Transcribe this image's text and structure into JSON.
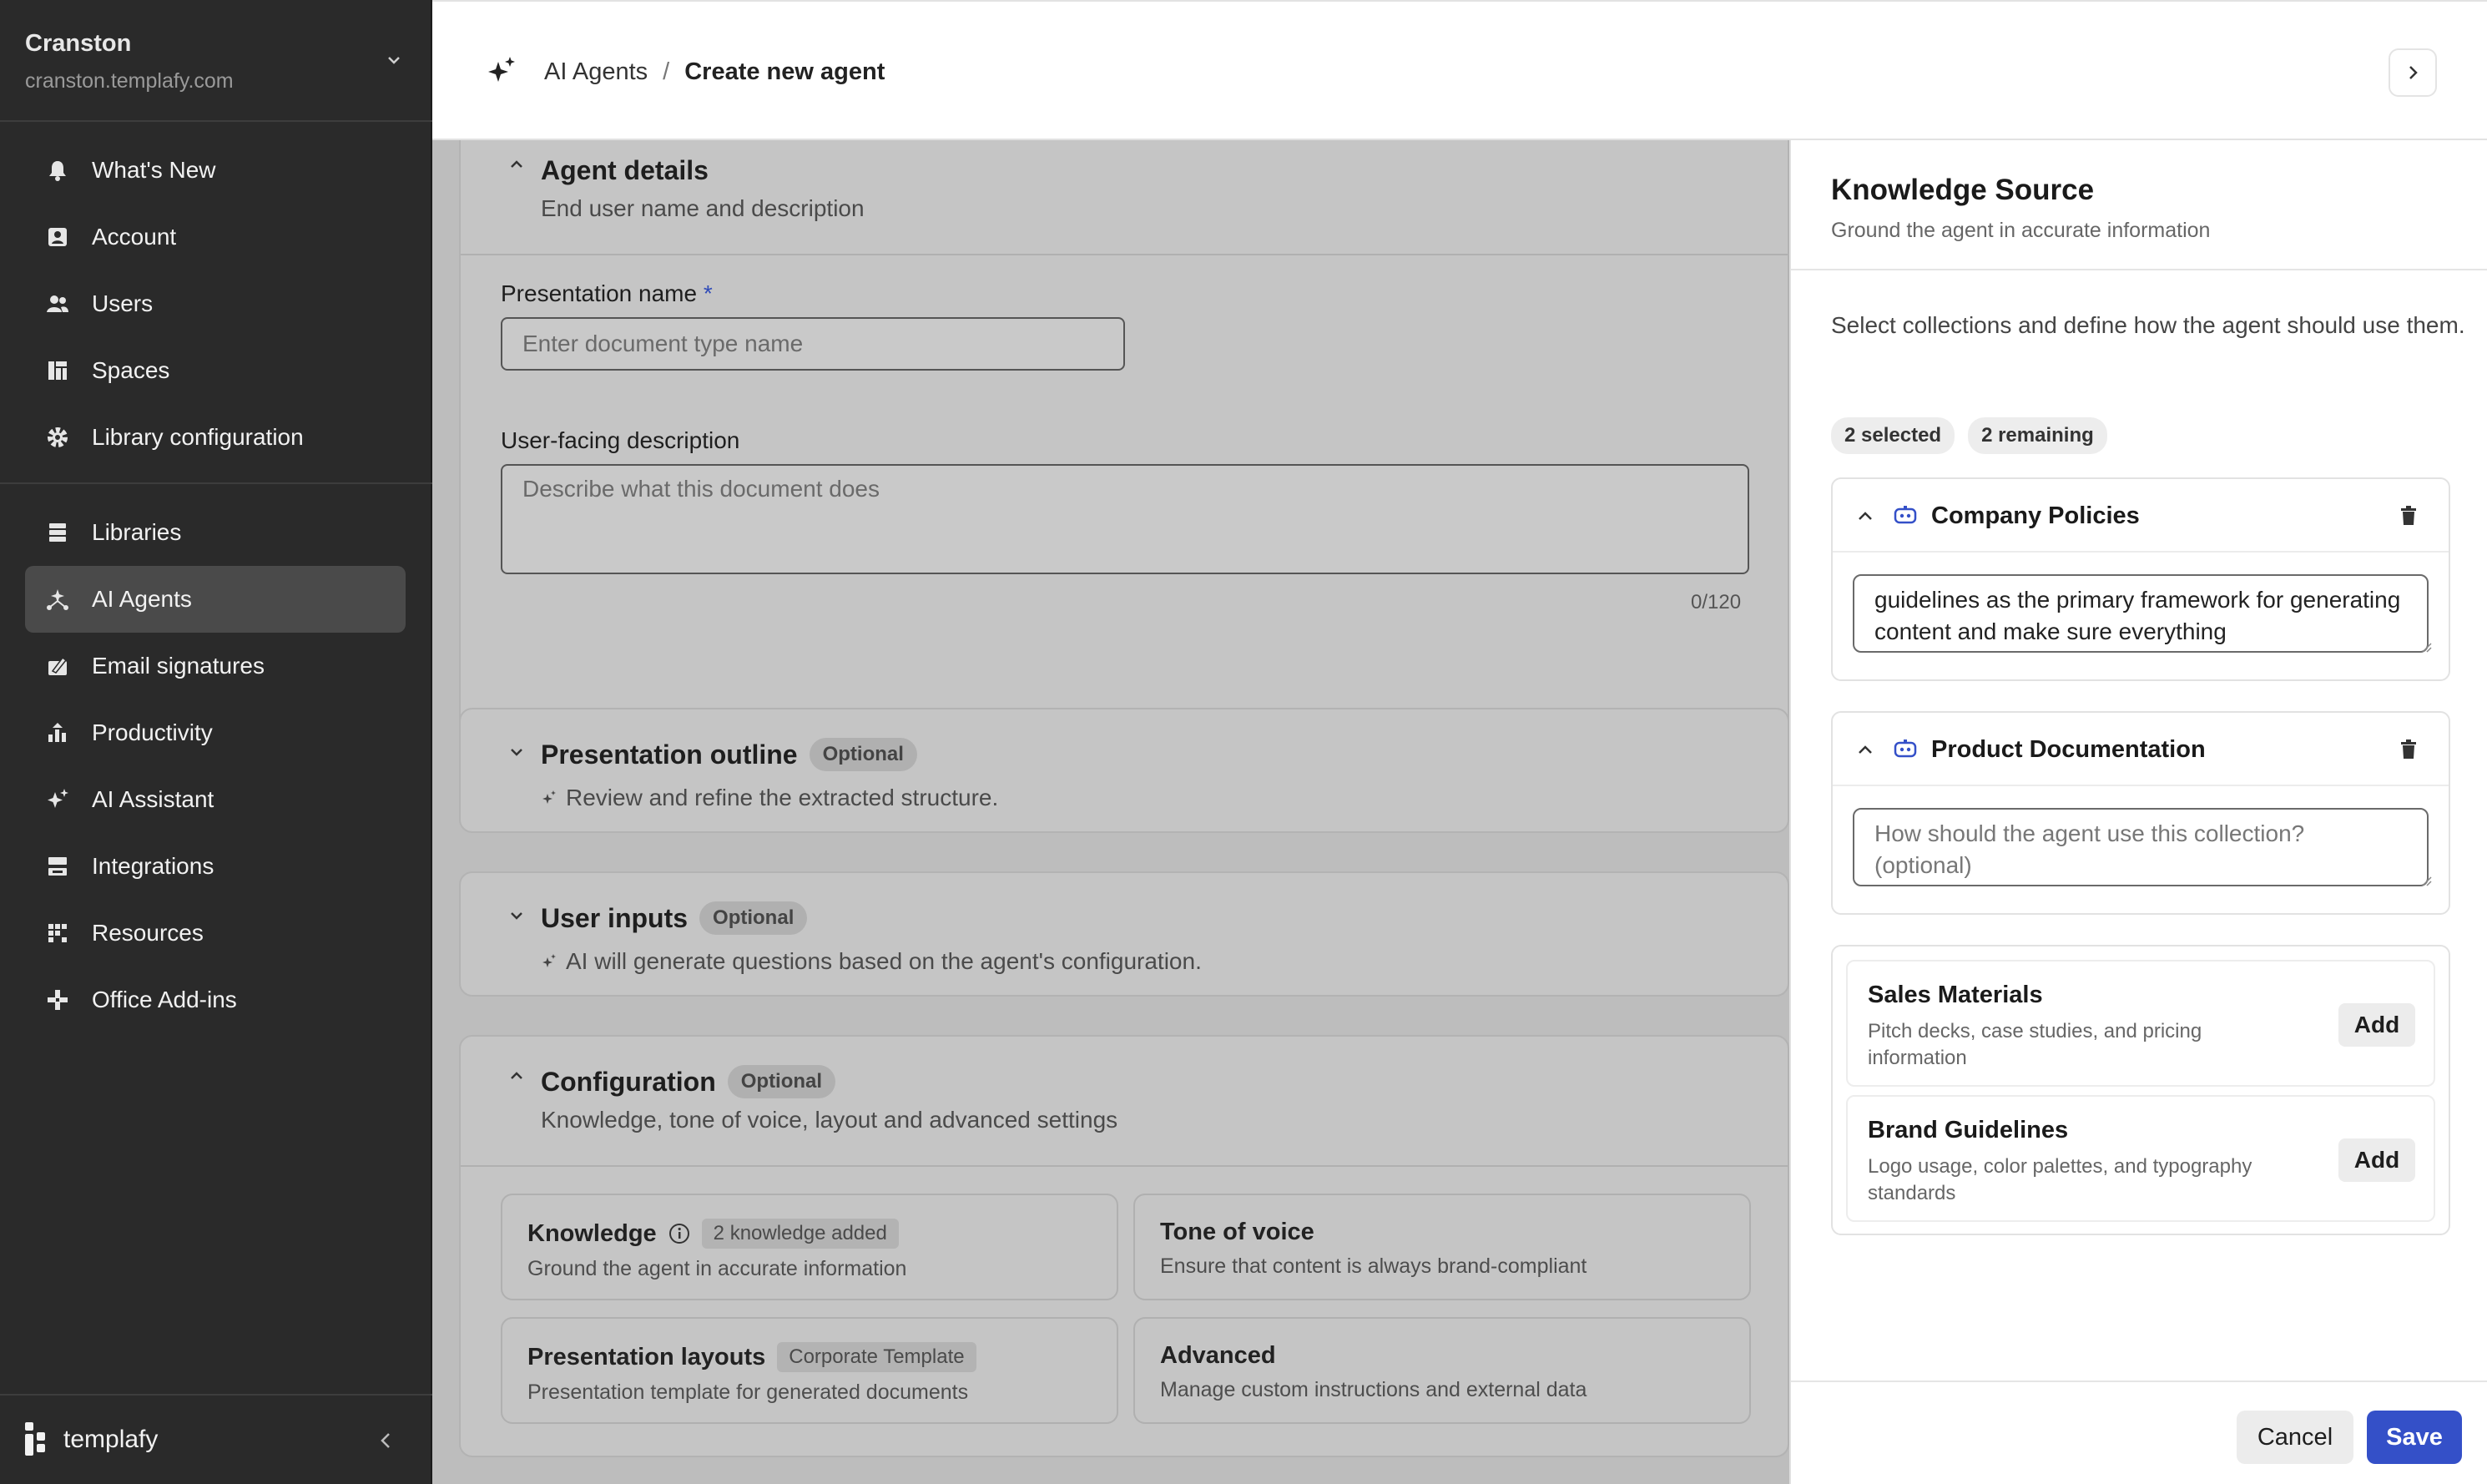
{
  "org": {
    "name": "Cranston",
    "domain": "cranston.templafy.com"
  },
  "nav_group1": [
    {
      "label": "What's New",
      "icon": "bell-icon"
    },
    {
      "label": "Account",
      "icon": "account-icon"
    },
    {
      "label": "Users",
      "icon": "users-icon"
    },
    {
      "label": "Spaces",
      "icon": "spaces-icon"
    },
    {
      "label": "Library configuration",
      "icon": "gear-icon"
    }
  ],
  "nav_group2": [
    {
      "label": "Libraries",
      "icon": "libraries-icon"
    },
    {
      "label": "AI Agents",
      "icon": "ai-agents-icon",
      "active": true
    },
    {
      "label": "Email signatures",
      "icon": "signature-icon"
    },
    {
      "label": "Productivity",
      "icon": "productivity-icon"
    },
    {
      "label": "AI Assistant",
      "icon": "sparkle-icon"
    },
    {
      "label": "Integrations",
      "icon": "integrations-icon"
    },
    {
      "label": "Resources",
      "icon": "resources-icon"
    },
    {
      "label": "Office Add-ins",
      "icon": "addins-icon"
    }
  ],
  "brand": "templafy",
  "breadcrumb": {
    "parent": "AI Agents",
    "separator": "/",
    "current": "Create new agent"
  },
  "agent_details": {
    "title": "Agent details",
    "subtitle": "End user name and description",
    "name_label": "Presentation name",
    "required_mark": "*",
    "name_placeholder": "Enter document type name",
    "desc_label": "User-facing description",
    "desc_placeholder": "Describe what this document does",
    "counter": "0/120"
  },
  "outline": {
    "title": "Presentation outline",
    "badge": "Optional",
    "subtitle": "Review and refine the extracted structure."
  },
  "user_inputs": {
    "title": "User inputs",
    "badge": "Optional",
    "subtitle": "AI will generate questions based on the agent's configuration."
  },
  "configuration": {
    "title": "Configuration",
    "badge": "Optional",
    "subtitle": "Knowledge, tone of voice, layout and advanced settings",
    "knowledge": {
      "title": "Knowledge",
      "tag": "2 knowledge added",
      "desc": "Ground the agent in accurate information"
    },
    "tone": {
      "title": "Tone of voice",
      "desc": "Ensure that content is always brand-compliant"
    },
    "layouts": {
      "title": "Presentation layouts",
      "tag": "Corporate Template",
      "desc": "Presentation template for generated documents"
    },
    "advanced": {
      "title": "Advanced",
      "desc": "Manage custom instructions and external data"
    }
  },
  "panel": {
    "title": "Knowledge Source",
    "subtitle": "Ground the agent in accurate information",
    "intro": "Select collections and define how the agent should use them.",
    "selected_chip": "2 selected",
    "remaining_chip": "2 remaining",
    "collections": [
      {
        "name": "Company Policies",
        "text": "guidelines as the primary framework for generating content and make sure everything"
      },
      {
        "name": "Product Documentation",
        "placeholder": "How should the agent use this collection? (optional)"
      }
    ],
    "available": [
      {
        "name": "Sales Materials",
        "desc": "Pitch decks, case studies, and pricing information",
        "action": "Add"
      },
      {
        "name": "Brand Guidelines",
        "desc": "Logo usage, color palettes, and typography standards",
        "action": "Add"
      }
    ],
    "cancel": "Cancel",
    "save": "Save"
  },
  "colors": {
    "sidebar": "#2a2a2a",
    "accent": "#3450c8",
    "overlay": "#bdbdbd"
  }
}
